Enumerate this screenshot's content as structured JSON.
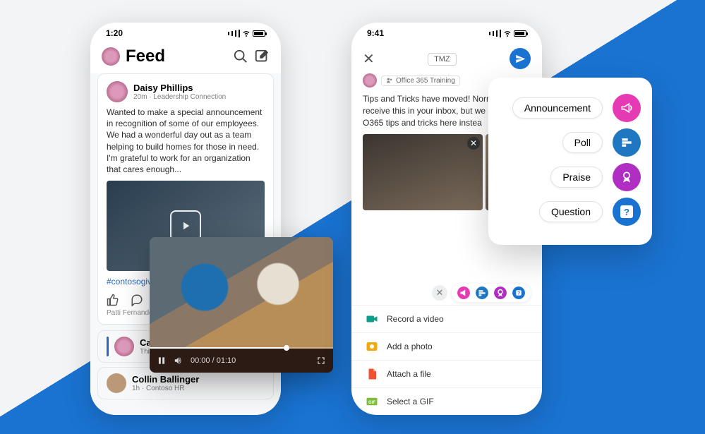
{
  "left": {
    "status_time": "1:20",
    "header_title": "Feed",
    "post": {
      "author": "Daisy Phillips",
      "meta": "20m · Leadership Connection",
      "text": "Wanted to make a special announcement in recognition of some of our employees. We had a wonderful day out as a team helping to build homes for those in need. I'm grateful to work for an organization that cares enough...",
      "hashtag": "#contosogives",
      "sub": "Patti Fernandez, C"
    },
    "reply_author": "Caro",
    "reply_text": "This",
    "next_author": "Collin Ballinger",
    "next_meta": "1h · Contoso HR"
  },
  "video": {
    "time": "00:00 / 01:10"
  },
  "right": {
    "status_time": "9:41",
    "chip": "TMZ",
    "tag": "Office 365 Training",
    "text": "Tips and Tricks have moved! Normally might receive this in your inbox, but we share O365 tips and tricks here instea",
    "options": {
      "video": "Record a video",
      "photo": "Add a photo",
      "file": "Attach a file",
      "gif": "Select a GIF"
    }
  },
  "type_menu": {
    "announcement": "Announcement",
    "poll": "Poll",
    "praise": "Praise",
    "question": "Question"
  }
}
